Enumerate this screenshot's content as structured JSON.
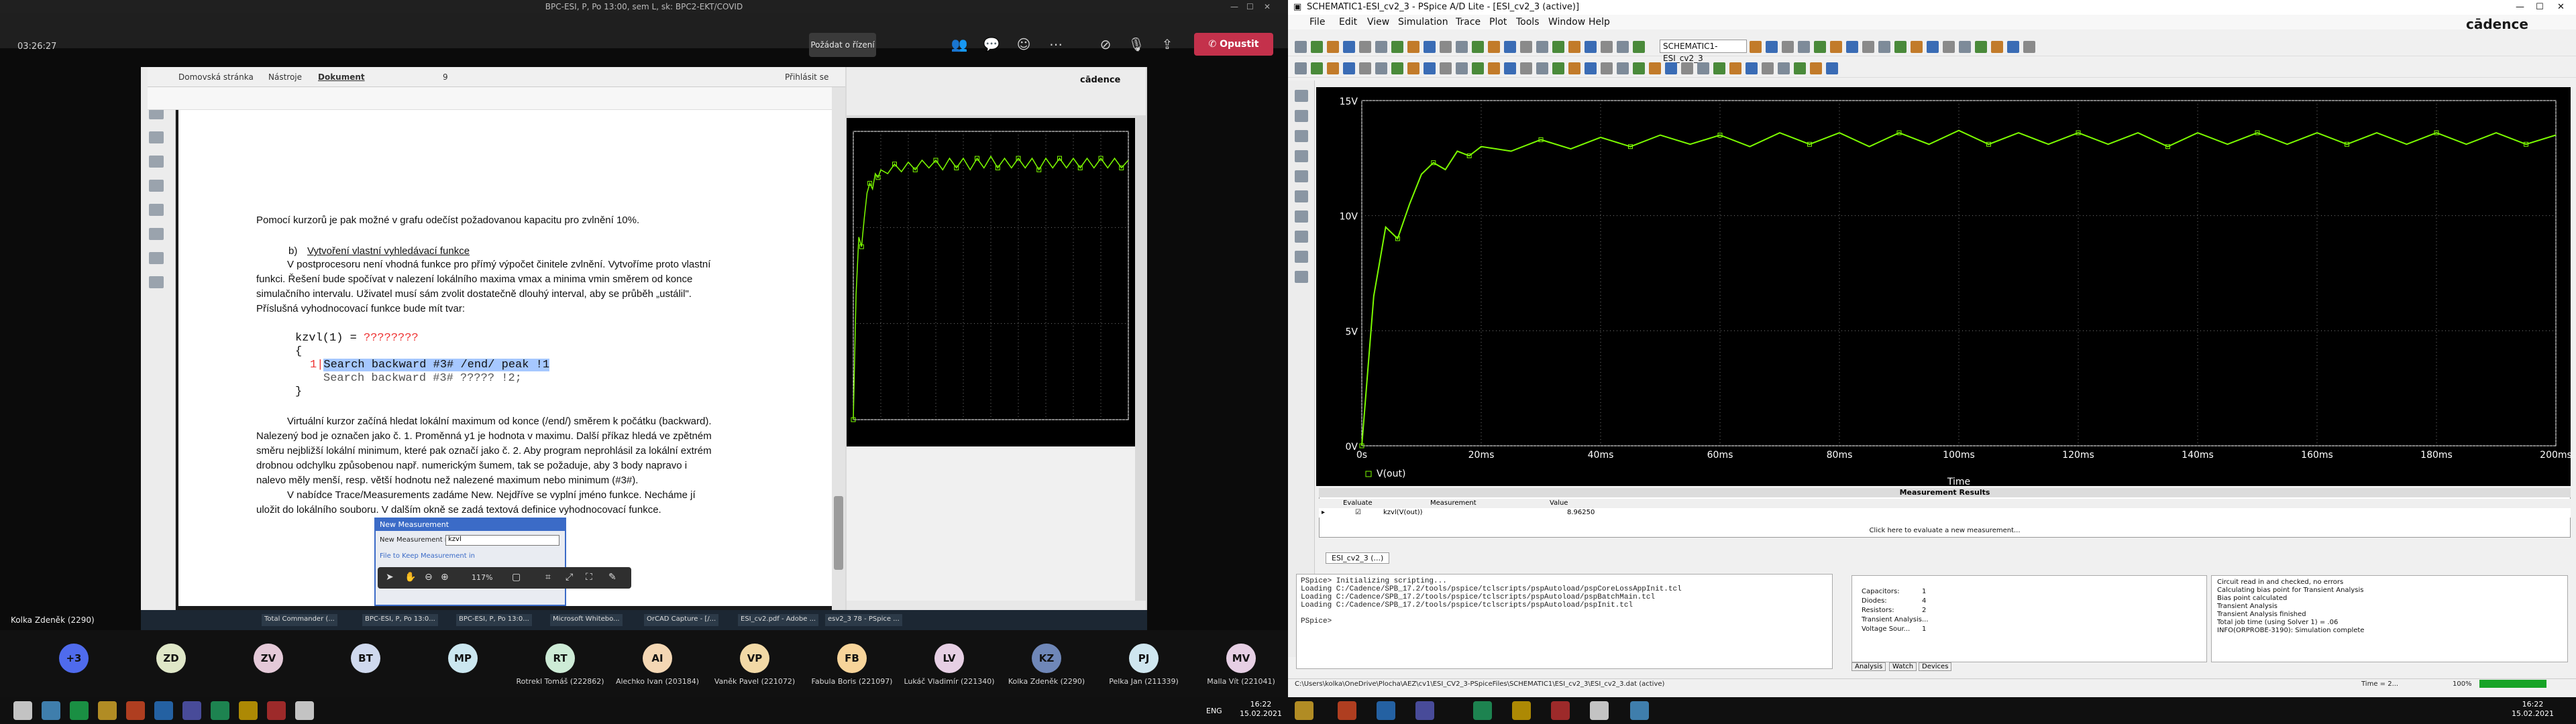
{
  "teams": {
    "window_title": "BPC-ESI, P, Po 13:00, sem L, sk: BPC2-EKT/COVID",
    "timer": "03:26:27",
    "raise_button": "Požádat o řízení",
    "leave_button": "Opustit",
    "self_name": "Kolka Zdeněk (2290)",
    "participants": [
      {
        "initials": "+3",
        "name": "",
        "color": "#4f6bed"
      },
      {
        "initials": "ZD",
        "name": "",
        "color": "#dfe7c8"
      },
      {
        "initials": "ZV",
        "name": "",
        "color": "#e4c9d8"
      },
      {
        "initials": "BT",
        "name": "",
        "color": "#cfd9ee"
      },
      {
        "initials": "MP",
        "name": "",
        "color": "#cbe7f0"
      },
      {
        "initials": "RT",
        "name": "Rotrekl Tomáš (222862)",
        "color": "#cdebd6"
      },
      {
        "initials": "AI",
        "name": "Alechko Ivan (203184)",
        "color": "#f4d7b4"
      },
      {
        "initials": "VP",
        "name": "Vaněk Pavel (221072)",
        "color": "#f2d9a6"
      },
      {
        "initials": "FB",
        "name": "Fabula Boris (221097)",
        "color": "#f7d49a"
      },
      {
        "initials": "LV",
        "name": "Lukáč Vladimír (221340)",
        "color": "#e6cfe4"
      },
      {
        "initials": "KZ",
        "name": "Kolka Zdeněk (2290)",
        "color": "#6f87b8"
      },
      {
        "initials": "PJ",
        "name": "Pelka Jan (211339)",
        "color": "#cfe6ef"
      },
      {
        "initials": "MV",
        "name": "Malla Vít (221041)",
        "color": "#e6cfe4"
      }
    ]
  },
  "pdf": {
    "tabs": [
      "Domovská stránka",
      "Nástroje",
      "Dokument"
    ],
    "active_tab": "Dokument",
    "signin": "Přihlásit se",
    "page_num": "9",
    "para1": "Pomocí kurzorů je pak možné v grafu odečíst požadovanou kapacitu pro zvlnění 10%.",
    "heading_b": "b)",
    "heading": "Vytvoření vlastní vyhledávací funkce",
    "para2_l1": "V postprocesoru není vhodná funkce pro přímý výpočet činitele zvlnění. Vytvoříme proto vlastní",
    "para2_l2": "funkci. Řešení bude spočívat v nalezení lokálního maxima vmax a minima vmin směrem od konce",
    "para2_l3": "simulačního intervalu. Uživatel musí sám zvolit dostatečně dlouhý interval, aby se průběh „ustálil\".",
    "para2_l4": "Příslušná vyhodnocovací funkce bude mít tvar:",
    "code1_a": "kzvl(1) = ",
    "code1_b": "????????",
    "code2": "{",
    "code3_num": "1|",
    "code3": "Search backward #3# /end/ peak !1",
    "code4": "Search backward #3# ????? !2;",
    "code5": "}",
    "para3_l1": "Virtuální kurzor začíná hledat lokální maximum od konce (/end/) směrem k počátku (backward).",
    "para3_l2": "Nalezený bod je označen jako č. 1. Proměnná y1 je hodnota v maximu. Další příkaz hledá ve zpětném",
    "para3_l3": "směru nejbližší lokální minimum, které pak označí jako č. 2. Aby program neprohlásil za lokální extrém",
    "para3_l4": "drobnou odchylku způsobenou např. numerickým šumem, tak se požaduje, aby 3 body napravo i",
    "para3_l5": "nalevo měly menší, resp. větší hodnotu než nalezené maximum nebo minimum (#3#).",
    "para4_l1": "V nabídce Trace/Measurements zadáme New. Nejdříve se vyplní jméno funkce. Necháme jí",
    "para4_l2": "uložit do lokálního souboru. V dalším okně se zadá textová definice vyhodnocovací funkce.",
    "dialog_title": "New Measurement",
    "dialog_label": "New Measurement name",
    "dialog_value": "kzvl",
    "dialog_link": "File to Keep Measurement in",
    "zoom": "117%"
  },
  "inner_taskbar": [
    "Total Commander (...",
    "BPC-ESI, P, Po 13:0...",
    "BPC-ESI, P, Po 13:0...",
    "Microsoft Whitebo...",
    "OrCAD Capture - [/...",
    "ESI_cv2.pdf - Adobe ...",
    "esv2_3 78 - PSpice ..."
  ],
  "pspice": {
    "window_title": "SCHEMATIC1-ESI_cv2_3 - PSpice A/D Lite - [ESI_cv2_3 (active)]",
    "menu": [
      "File",
      "Edit",
      "View",
      "Simulation",
      "Trace",
      "Plot",
      "Tools",
      "Window",
      "Help"
    ],
    "profile": "SCHEMATIC1-ESI_cv2_3",
    "logo": "cādence",
    "plot_tab": "ESI_cv2_3 (...)",
    "measurements_title": "Measurement Results",
    "meas_cols": [
      "Evaluate",
      "Measurement",
      "Value"
    ],
    "meas_row": {
      "evaluate": "☑",
      "measurement": "kzvl(V(out))",
      "value": "8.96250"
    },
    "meas_add": "Click here to evaluate a new measurement...",
    "console": [
      "PSpice> Initializing scripting...",
      "Loading C:/Cadence/SPB_17.2/tools/pspice/tclscripts/pspAutoload/pspCoreLossAppInit.tcl",
      "Loading C:/Cadence/SPB_17.2/tools/pspice/tclscripts/pspAutoload/pspBatchMain.tcl",
      "Loading C:/Cadence/SPB_17.2/tools/pspice/tclscripts/pspAutoload/pspInit.tcl",
      "",
      "PSpice>"
    ],
    "watch": [
      {
        "k": "Capacitors:",
        "v": "1"
      },
      {
        "k": "Diodes:",
        "v": "4"
      },
      {
        "k": "Resistors:",
        "v": "2"
      },
      {
        "k": "Transient Analysis...",
        "v": ""
      },
      {
        "k": "Voltage Sour...",
        "v": "1"
      }
    ],
    "watch_tabs": [
      "Analysis",
      "Watch",
      "Devices"
    ],
    "simlog": [
      "Circuit read in and checked, no errors",
      "Calculating bias point for Transient Analysis",
      "Bias point calculated",
      "Transient Analysis",
      "Transient Analysis finished",
      "Total job time (using Solver 1)  =  .06",
      "INFO(ORPROBE-3190): Simulation complete"
    ],
    "status_path": "C:\\Users\\kolka\\OneDrive\\Plocha\\AEZ\\cv1\\ESI_CV2_3-PSpiceFiles\\SCHEMATIC1\\ESI_cv2_3\\ESI_cv2_3.dat (active)",
    "status_pct": "100%",
    "status_time": "Time = 2...",
    "cursor": "Time = 2"
  },
  "clock": {
    "time": "16:22",
    "date": "15.02.2021"
  },
  "lang": "ENG",
  "chart_data": {
    "type": "line",
    "title": "",
    "xlabel": "Time",
    "ylabel": "",
    "series": [
      {
        "name": "V(out)",
        "color": "#7CFC00",
        "x": [
          0,
          2,
          4,
          6,
          8,
          10,
          12,
          14,
          16,
          18,
          20,
          25,
          30,
          35,
          40,
          45,
          50,
          55,
          60,
          65,
          70,
          75,
          80,
          85,
          90,
          95,
          100,
          105,
          110,
          115,
          120,
          125,
          130,
          135,
          140,
          145,
          150,
          155,
          160,
          165,
          170,
          175,
          180,
          185,
          190,
          195,
          200
        ],
        "y": [
          0,
          6.5,
          9.5,
          9.0,
          10.5,
          11.8,
          12.3,
          12.0,
          12.8,
          12.6,
          13.0,
          12.8,
          13.3,
          12.9,
          13.4,
          13.0,
          13.5,
          13.1,
          13.5,
          13.0,
          13.6,
          13.1,
          13.6,
          13.0,
          13.6,
          13.1,
          13.7,
          13.1,
          13.6,
          13.1,
          13.6,
          13.1,
          13.6,
          13.0,
          13.6,
          13.1,
          13.6,
          13.1,
          13.6,
          13.1,
          13.6,
          13.1,
          13.6,
          13.1,
          13.6,
          13.1,
          13.5
        ]
      }
    ],
    "x_ticks": [
      "0s",
      "20ms",
      "40ms",
      "60ms",
      "80ms",
      "100ms",
      "120ms",
      "140ms",
      "160ms",
      "180ms",
      "200ms"
    ],
    "y_ticks": [
      "0V",
      "5V",
      "10V",
      "15V"
    ],
    "xlim": [
      0,
      200
    ],
    "ylim": [
      0,
      15
    ],
    "grid": true,
    "legend": "bottom-left"
  }
}
